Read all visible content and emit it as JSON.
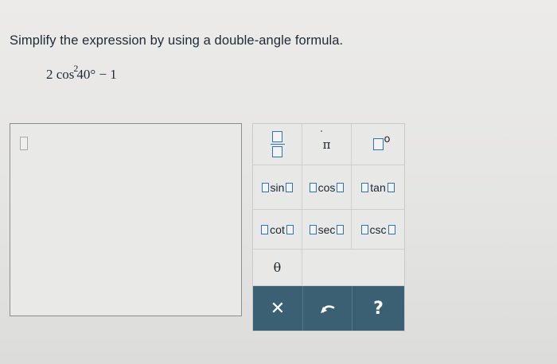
{
  "question": {
    "instructions": "Simplify the expression by using a double-angle formula.",
    "expression": {
      "coef_fn": "2 cos",
      "exponent": "2",
      "after": "40° − 1"
    }
  },
  "answer_area": {
    "current_value": ""
  },
  "palette": {
    "pi_label": "π",
    "degree_label": "o",
    "trig": {
      "sin": "sin",
      "cos": "cos",
      "tan": "tan",
      "cot": "cot",
      "sec": "sec",
      "csc": "csc"
    },
    "theta_label": "θ"
  },
  "actions": {
    "clear_label": "✕",
    "undo_icon": "undo-icon",
    "help_label": "?"
  },
  "colors": {
    "accent_placeholder": "#2a72c4",
    "action_bar": "#3b6073"
  }
}
